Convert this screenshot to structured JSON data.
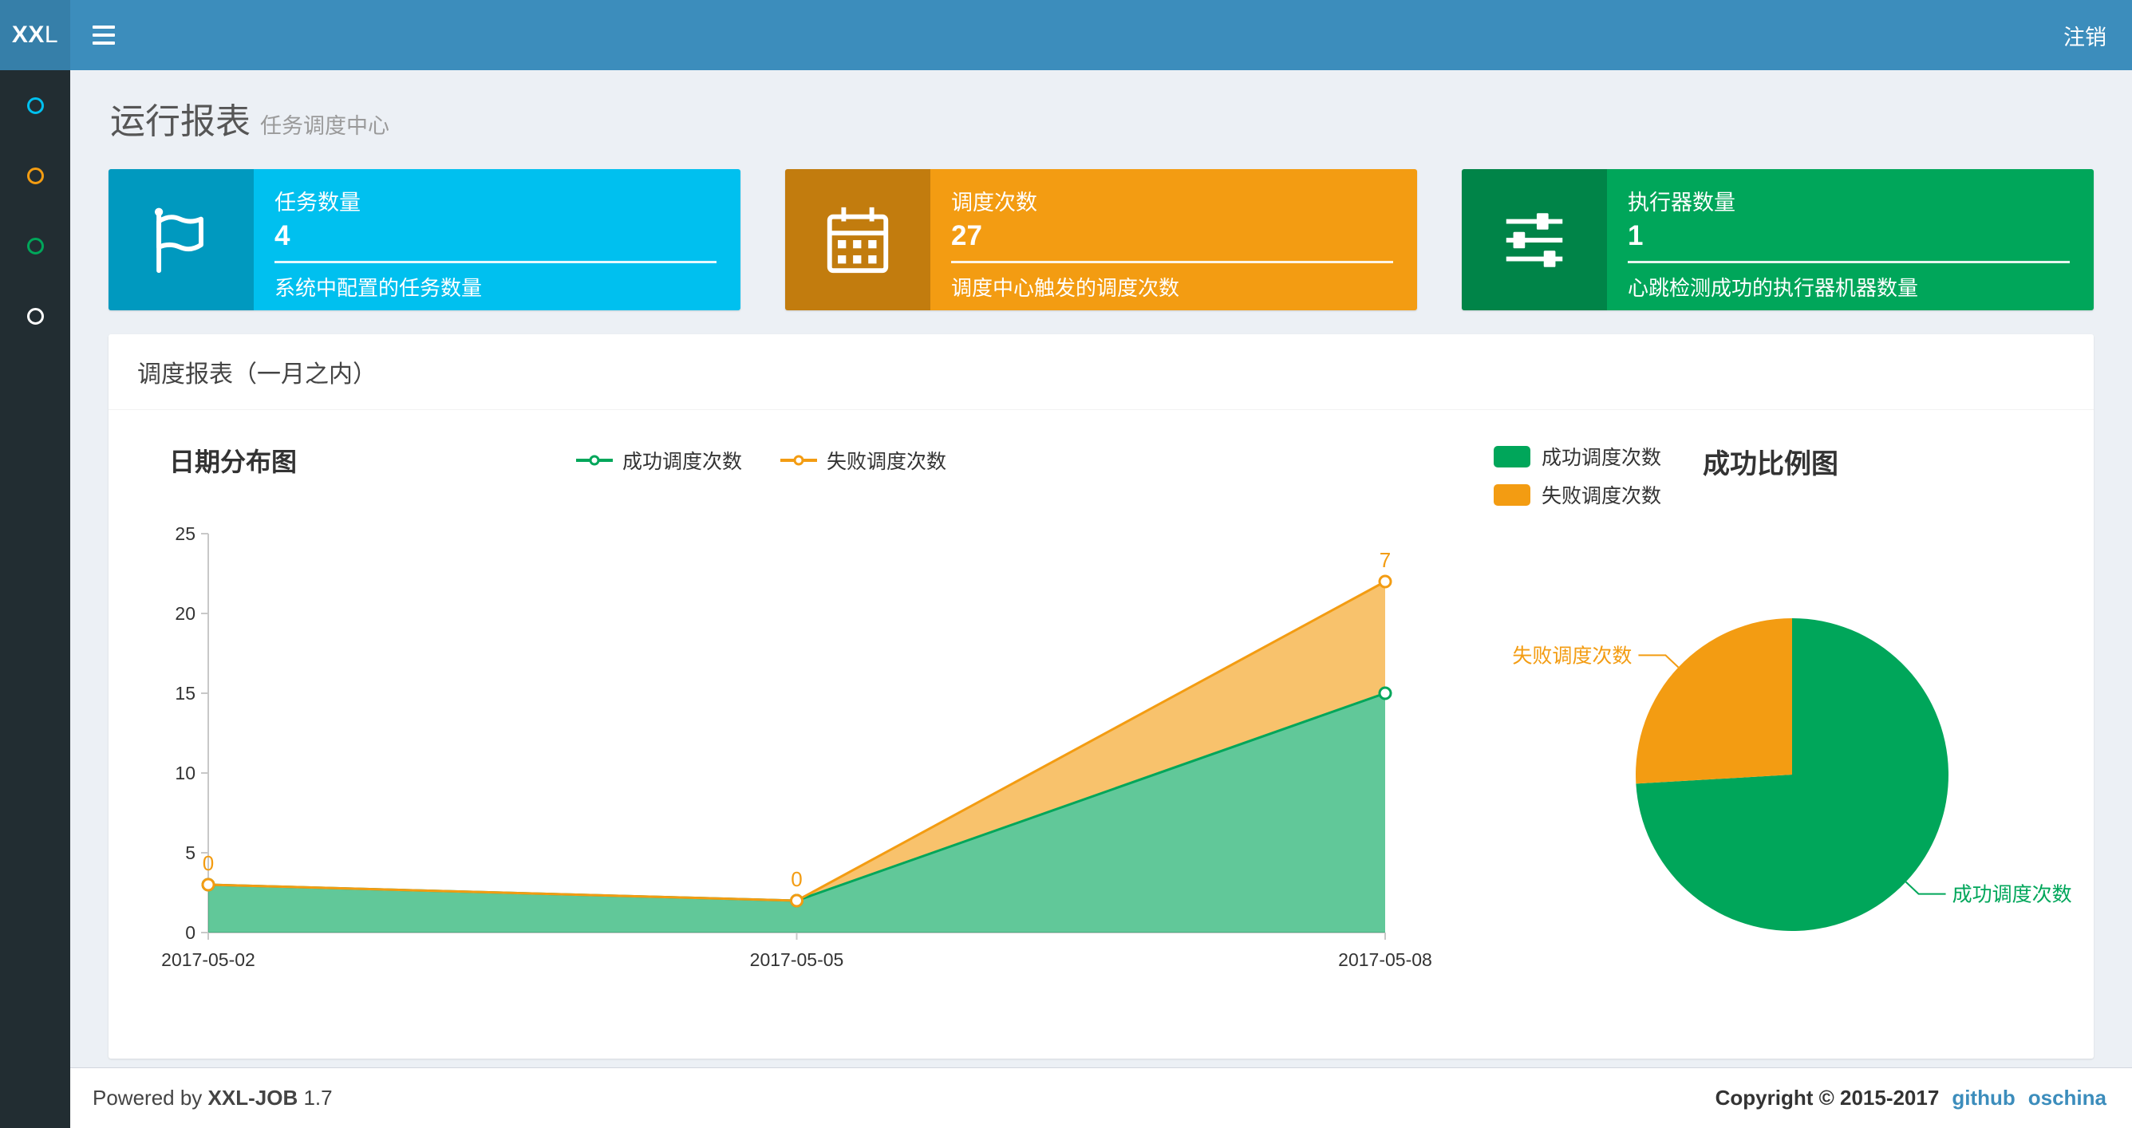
{
  "navbar": {
    "logo_bold": "XX",
    "logo_rest": "L",
    "logout": "注销"
  },
  "sidebar": {
    "items": [
      {
        "color": "#00c0ef"
      },
      {
        "color": "#f39c12"
      },
      {
        "color": "#00a65a"
      },
      {
        "color": "#ffffff"
      }
    ]
  },
  "header": {
    "title": "运行报表",
    "subtitle": "任务调度中心"
  },
  "info_boxes": [
    {
      "title": "任务数量",
      "value": "4",
      "desc": "系统中配置的任务数量",
      "color": "#00c0ef",
      "icon": "flag-icon"
    },
    {
      "title": "调度次数",
      "value": "27",
      "desc": "调度中心触发的调度次数",
      "color": "#f39c12",
      "icon": "calendar-icon"
    },
    {
      "title": "执行器数量",
      "value": "1",
      "desc": "心跳检测成功的执行器机器数量",
      "color": "#00a65a",
      "icon": "sliders-icon"
    }
  ],
  "panel": {
    "title": "调度报表（一月之内）"
  },
  "chart_data": [
    {
      "type": "area",
      "title": "日期分布图",
      "categories": [
        "2017-05-02",
        "2017-05-05",
        "2017-05-08"
      ],
      "series": [
        {
          "name": "成功调度次数",
          "values": [
            3,
            2,
            15
          ],
          "color": "#00a65a"
        },
        {
          "name": "失败调度次数",
          "values": [
            0,
            0,
            7
          ],
          "color": "#f39c12"
        }
      ],
      "stacked": true,
      "ylim": [
        0,
        25
      ],
      "yticks": [
        0,
        5,
        10,
        15,
        20,
        25
      ],
      "point_labels": [
        "0",
        "0",
        "7"
      ],
      "grid": false,
      "legend_position": "top-center"
    },
    {
      "type": "pie",
      "title": "成功比例图",
      "slices": [
        {
          "name": "成功调度次数",
          "value": 20,
          "color": "#00a65a"
        },
        {
          "name": "失败调度次数",
          "value": 7,
          "color": "#f39c12"
        }
      ],
      "legend_position": "top-left"
    }
  ],
  "footer": {
    "powered_prefix": "Powered by",
    "product": "XXL-JOB",
    "version": "1.7",
    "copyright": "Copyright © 2015-2017",
    "links": [
      "github",
      "oschina"
    ]
  }
}
